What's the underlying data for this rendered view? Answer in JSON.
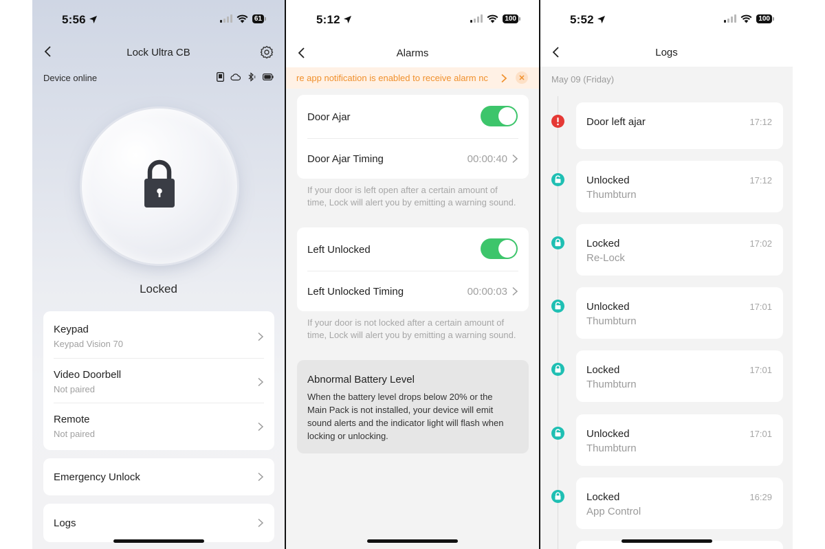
{
  "colors": {
    "toggle_on": "#3dc56b",
    "banner_text": "#f0902c",
    "banner_bg": "#fff1e5",
    "log_dot": "#1fbfb3",
    "alert_dot": "#e53935"
  },
  "screen1": {
    "status": {
      "time": "5:56",
      "battery": "61"
    },
    "title": "Lock Ultra CB",
    "device_status": "Device online",
    "lock_state": "Locked",
    "items": [
      {
        "title": "Keypad",
        "subtitle": "Keypad Vision 70"
      },
      {
        "title": "Video Doorbell",
        "subtitle": "Not paired"
      },
      {
        "title": "Remote",
        "subtitle": "Not paired"
      }
    ],
    "emergency": "Emergency Unlock",
    "logs": "Logs"
  },
  "screen2": {
    "status": {
      "time": "5:12",
      "battery": "100"
    },
    "title": "Alarms",
    "banner": "re app notification is enabled to receive alarm nc",
    "door_ajar": {
      "label": "Door Ajar",
      "enabled": true,
      "timing_label": "Door Ajar Timing",
      "timing_value": "00:00:40"
    },
    "door_ajar_hint": "If your door is left open after a certain amount of time, Lock will alert you by emitting a warning sound.",
    "left_unlocked": {
      "label": "Left Unlocked",
      "enabled": true,
      "timing_label": "Left Unlocked Timing",
      "timing_value": "00:00:03"
    },
    "left_unlocked_hint": "If your door is not locked after a certain amount of time, Lock will alert you by emitting a warning sound.",
    "battery_title": "Abnormal Battery Level",
    "battery_text": "When the battery level drops below 20% or the Main Pack is not installed, your device will emit sound alerts and the indicator light will flash when locking or unlocking."
  },
  "screen3": {
    "status": {
      "time": "5:52",
      "battery": "100"
    },
    "title": "Logs",
    "date": "May 09 (Friday)",
    "entries": [
      {
        "title": "Door left ajar",
        "subtitle": "",
        "time": "17:12",
        "icon": "alert-icon"
      },
      {
        "title": "Unlocked",
        "subtitle": "Thumbturn",
        "time": "17:12",
        "icon": "unlock-icon"
      },
      {
        "title": "Locked",
        "subtitle": "Re-Lock",
        "time": "17:02",
        "icon": "lock-icon"
      },
      {
        "title": "Unlocked",
        "subtitle": "Thumbturn",
        "time": "17:01",
        "icon": "unlock-icon"
      },
      {
        "title": "Locked",
        "subtitle": "Thumbturn",
        "time": "17:01",
        "icon": "lock-icon"
      },
      {
        "title": "Unlocked",
        "subtitle": "Thumbturn",
        "time": "17:01",
        "icon": "unlock-icon"
      },
      {
        "title": "Locked",
        "subtitle": "App Control",
        "time": "16:29",
        "icon": "lock-icon"
      }
    ]
  }
}
